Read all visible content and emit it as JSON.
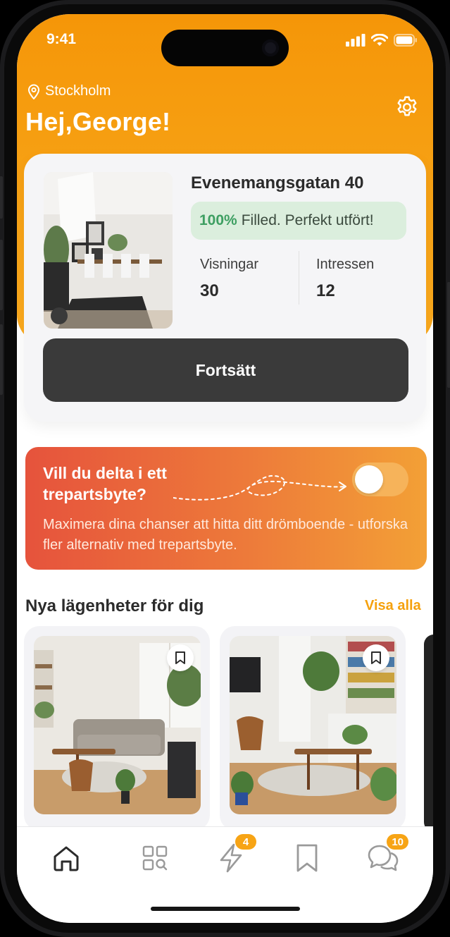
{
  "status_bar": {
    "time": "9:41"
  },
  "header": {
    "location": "Stockholm",
    "greeting": "Hej,George!"
  },
  "listing_card": {
    "address": "Evenemangsgatan 40",
    "progress_percent": "100%",
    "progress_text": "Filled. Perfekt utfört!",
    "stats": [
      {
        "label": "Visningar",
        "value": "30"
      },
      {
        "label": "Intressen",
        "value": "12"
      }
    ],
    "button_label": "Fortsätt"
  },
  "swap_banner": {
    "title": "Vill du delta i ett trepartsbyte?",
    "description": "Maximera dina chanser att hitta ditt drömboende - utforska fler alternativ med trepartsbyte.",
    "toggle_on": false
  },
  "section": {
    "title": "Nya lägenheter för dig",
    "link_label": "Visa alla"
  },
  "tabbar": {
    "items": [
      {
        "name": "home",
        "icon": "home-icon",
        "active": true
      },
      {
        "name": "search",
        "icon": "grid-search-icon"
      },
      {
        "name": "matches",
        "icon": "lightning-icon",
        "badge": "4"
      },
      {
        "name": "saved",
        "icon": "bookmark-icon"
      },
      {
        "name": "messages",
        "icon": "chat-icon",
        "badge": "10"
      }
    ]
  },
  "colors": {
    "accent": "#F5A10D",
    "banner_start": "#E6533C",
    "button_dark": "#3A3A3A",
    "success": "#3E9F62"
  }
}
